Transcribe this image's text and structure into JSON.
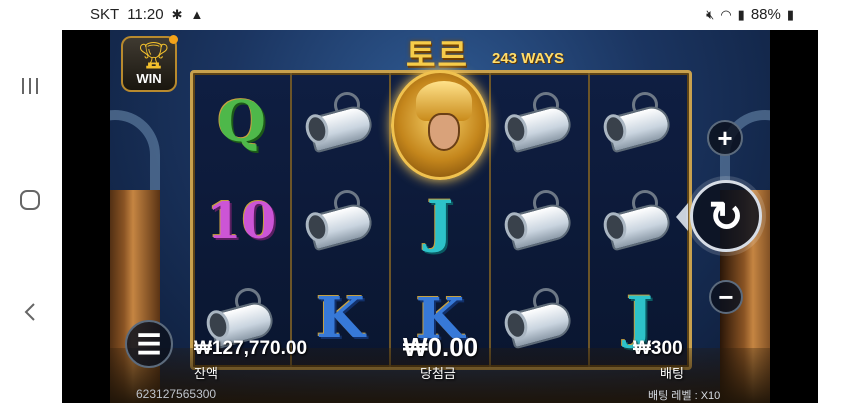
{
  "status_bar": {
    "carrier": "SKT",
    "time": "11:20",
    "battery": "88%",
    "icons": [
      "bug-icon",
      "alert-icon",
      "mute-icon",
      "wifi-icon",
      "signal-icon",
      "battery-icon"
    ]
  },
  "game": {
    "title": "토르",
    "ways": "243 WAYS",
    "win_button_label": "WIN",
    "reels": [
      [
        "Q",
        "10",
        "horn"
      ],
      [
        "horn",
        "horn",
        "K"
      ],
      [
        "thor",
        "J",
        "K"
      ],
      [
        "horn",
        "horn",
        "horn"
      ],
      [
        "horn",
        "horn",
        "J"
      ]
    ],
    "balance_value": "₩127,770.00",
    "balance_label": "잔액",
    "win_value": "₩0.00",
    "win_label": "당첨금",
    "bet_value": "₩300",
    "bet_label": "배팅",
    "session_id": "623127565300",
    "bet_level": "배팅 레벨 : X10",
    "controls": {
      "plus": "+",
      "minus": "−",
      "spin": "↻",
      "menu": "☰"
    }
  }
}
